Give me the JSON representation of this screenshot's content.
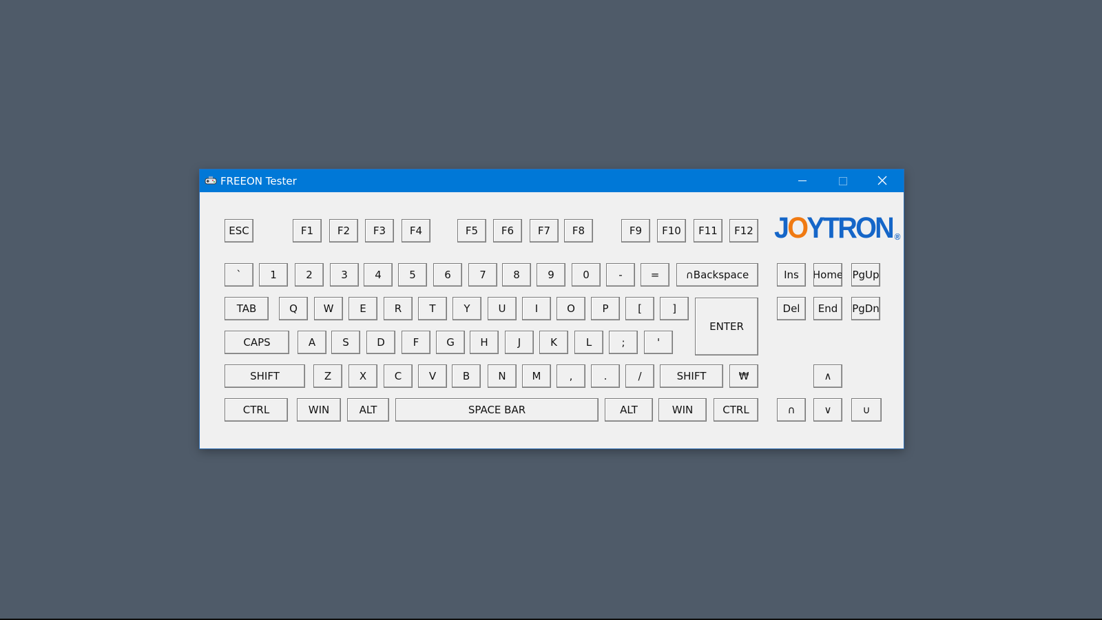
{
  "window": {
    "title": "FREEON Tester",
    "icon": "gamepad-icon",
    "controls": {
      "minimize": "minimize-icon",
      "maximize": "maximize-icon",
      "close": "close-icon"
    }
  },
  "logo": {
    "text_1": "J",
    "text_2": "O",
    "text_3": "YTRON",
    "reg": "®",
    "colors": {
      "primary": "#1566c8",
      "accent": "#f07a12"
    }
  },
  "keys": {
    "esc": "ESC",
    "f1": "F1",
    "f2": "F2",
    "f3": "F3",
    "f4": "F4",
    "f5": "F5",
    "f6": "F6",
    "f7": "F7",
    "f8": "F8",
    "f9": "F9",
    "f10": "F10",
    "f11": "F11",
    "f12": "F12",
    "backtick": "`",
    "d1": "1",
    "d2": "2",
    "d3": "3",
    "d4": "4",
    "d5": "5",
    "d6": "6",
    "d7": "7",
    "d8": "8",
    "d9": "9",
    "d0": "0",
    "minus": "-",
    "equals": "=",
    "backspace": "∩Backspace",
    "tab": "TAB",
    "q": "Q",
    "w": "W",
    "e": "E",
    "r": "R",
    "t": "T",
    "y": "Y",
    "u": "U",
    "i": "I",
    "o": "O",
    "p": "P",
    "lbracket": "[",
    "rbracket": "]",
    "enter": "ENTER",
    "caps": "CAPS",
    "a": "A",
    "s": "S",
    "d": "D",
    "f": "F",
    "g": "G",
    "h": "H",
    "j": "J",
    "k": "K",
    "l": "L",
    "semicolon": ";",
    "quote": "'",
    "lshift": "SHIFT",
    "z": "Z",
    "x": "X",
    "c": "C",
    "v": "V",
    "b": "B",
    "n": "N",
    "m": "M",
    "comma": ",",
    "period": ".",
    "slash": "/",
    "rshift": "SHIFT",
    "won": "₩",
    "lctrl": "CTRL",
    "lwin": "WIN",
    "lalt": "ALT",
    "space": "SPACE BAR",
    "ralt": "ALT",
    "rwin": "WIN",
    "rctrl": "CTRL",
    "ins": "Ins",
    "home": "Home",
    "pgup": "PgUp",
    "del": "Del",
    "end": "End",
    "pgdn": "PgDn",
    "up": "∧",
    "left": "∩",
    "down": "∨",
    "right": "∪"
  }
}
